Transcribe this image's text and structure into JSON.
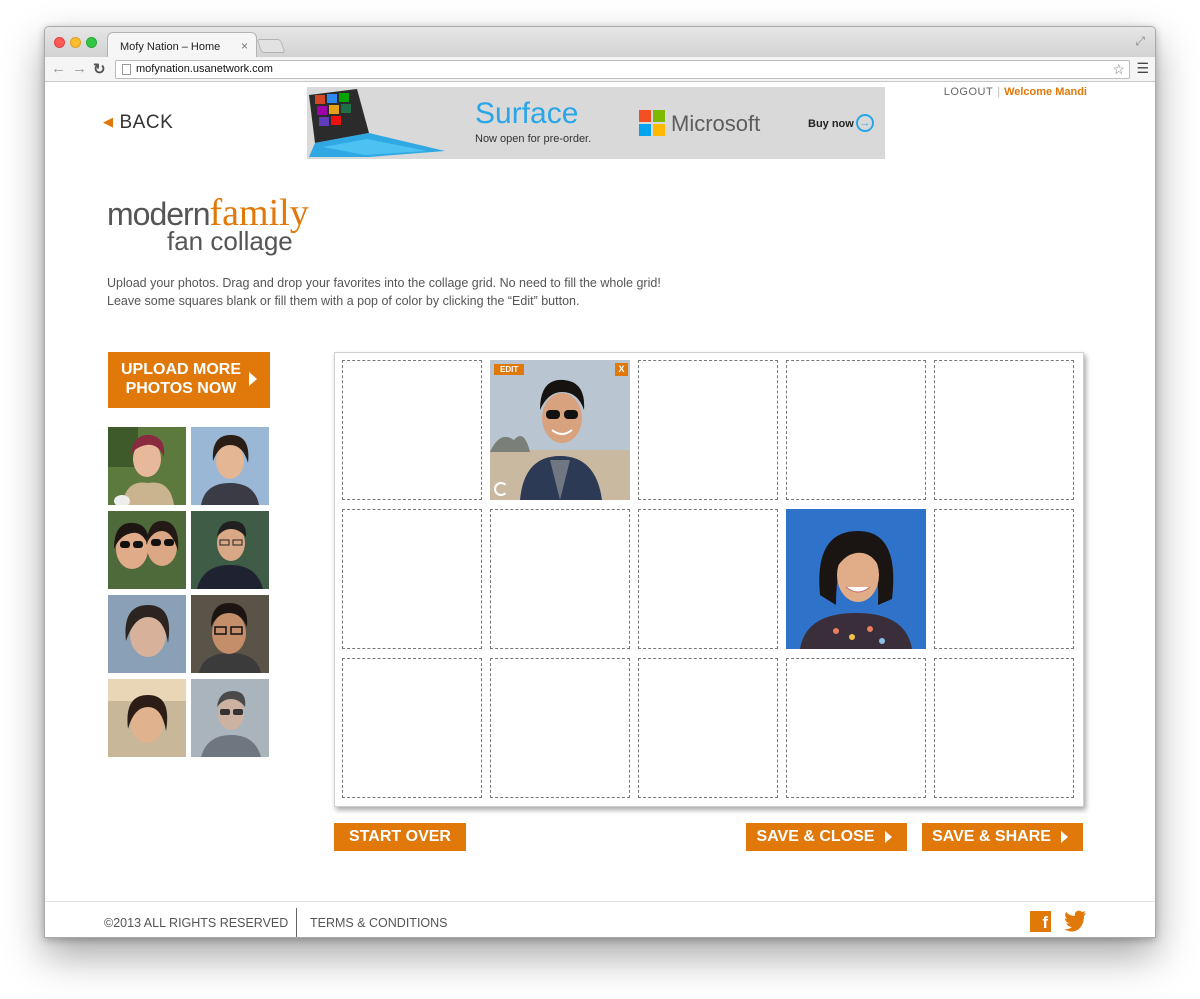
{
  "browser": {
    "tab_title": "Mofy Nation – Home",
    "tab_close": "×",
    "url": "mofynation.usanetwork.com",
    "back_glyph": "←",
    "forward_glyph": "→",
    "reload_glyph": "↻",
    "star_glyph": "☆",
    "menu_glyph": "☰",
    "fullscreen_glyph": "⤢"
  },
  "header": {
    "back_label": "BACK",
    "logout_label": "LOGOUT",
    "separator": "|",
    "welcome_label": "Welcome Mandi"
  },
  "ad": {
    "headline": "Surface",
    "subline": "Now open for pre-order.",
    "brand": "Microsoft",
    "cta": "Buy now",
    "cta_glyph": "→",
    "colors": {
      "blue": "#29a6e8",
      "ms_red": "#f25022",
      "ms_green": "#7fba00",
      "ms_blue": "#00a4ef",
      "ms_yellow": "#ffb900"
    }
  },
  "logo": {
    "word_modern": "modern",
    "word_family": "family",
    "line2": "fan collage"
  },
  "instructions": {
    "line1": "Upload your photos. Drag and drop your favorites into the collage grid. No need to fill the whole grid!",
    "line2": "Leave some squares blank or fill them with a pop of color by  clicking the “Edit” button."
  },
  "upload": {
    "line1": "UPLOAD MORE",
    "line2": "PHOTOS NOW"
  },
  "collage": {
    "edit_label": "EDIT",
    "remove_label": "X"
  },
  "actions": {
    "start_over": "START OVER",
    "save_close": "SAVE & CLOSE",
    "save_share": "SAVE & SHARE"
  },
  "footer": {
    "copyright": "©2013  ALL RIGHTS RESERVED",
    "terms": "TERMS & CONDITIONS",
    "facebook_glyph": "f"
  },
  "colors": {
    "accent": "#e0780a",
    "text": "#555555"
  }
}
